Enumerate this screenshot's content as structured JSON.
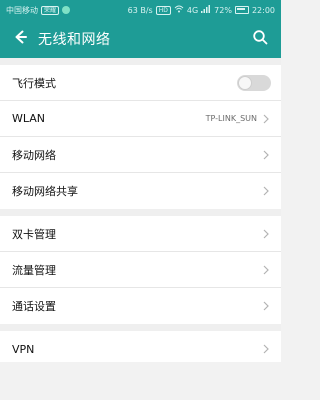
{
  "status": {
    "carrier": "中国移动",
    "carrier_badge": "荣耀",
    "speed": "63 B/s",
    "hd": "HD",
    "signal_type": "4G",
    "battery": "72%",
    "time": "22:00"
  },
  "header": {
    "title": "无线和网络",
    "back_icon": "arrow-left",
    "search_icon": "search",
    "color": "#1e9c96"
  },
  "sections": [
    {
      "items": [
        {
          "label": "飞行模式",
          "type": "toggle",
          "value": "off"
        },
        {
          "label": "WLAN",
          "type": "nav",
          "value": "TP-LINK_SUN"
        },
        {
          "label": "移动网络",
          "type": "nav"
        },
        {
          "label": "移动网络共享",
          "type": "nav"
        }
      ]
    },
    {
      "items": [
        {
          "label": "双卡管理",
          "type": "nav"
        },
        {
          "label": "流量管理",
          "type": "nav"
        },
        {
          "label": "通话设置",
          "type": "nav"
        }
      ]
    },
    {
      "items": [
        {
          "label": "VPN",
          "type": "nav"
        }
      ]
    }
  ]
}
